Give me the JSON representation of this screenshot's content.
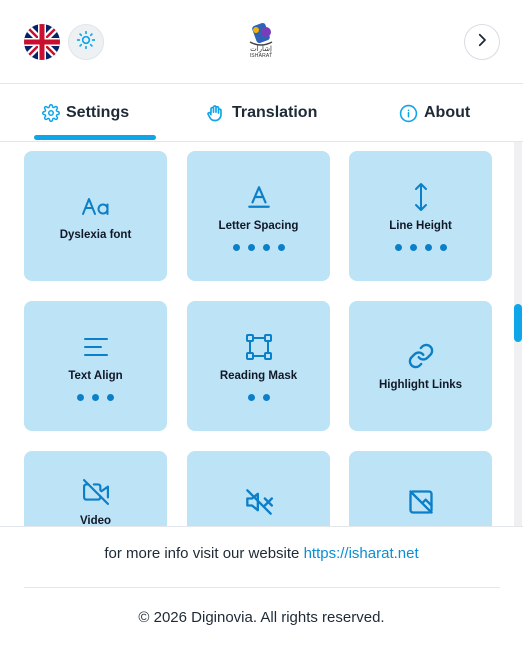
{
  "header": {
    "language_flag": "uk-flag-icon",
    "theme_icon": "sun-icon",
    "logo_text": "ISHARAT",
    "next_icon": "chevron-right-icon"
  },
  "tabs": [
    {
      "label": "Settings",
      "icon": "gear-icon",
      "active": true
    },
    {
      "label": "Translation",
      "icon": "hand-icon",
      "active": false
    },
    {
      "label": "About",
      "icon": "info-icon",
      "active": false
    }
  ],
  "tiles": [
    {
      "label": "Dyslexia font",
      "icon": "font-aa-icon",
      "dots": 0
    },
    {
      "label": "Letter Spacing",
      "icon": "letter-spacing-icon",
      "dots": 4
    },
    {
      "label": "Line Height",
      "icon": "line-height-icon",
      "dots": 4
    },
    {
      "label": "Text Align",
      "icon": "text-align-icon",
      "dots": 3
    },
    {
      "label": "Reading Mask",
      "icon": "reading-mask-icon",
      "dots": 2
    },
    {
      "label": "Highlight Links",
      "icon": "link-icon",
      "dots": 0
    },
    {
      "label": "Video",
      "icon": "video-off-icon",
      "dots": 0
    },
    {
      "label": "",
      "icon": "sound-off-icon",
      "dots": 0
    },
    {
      "label": "",
      "icon": "image-off-icon",
      "dots": 0
    }
  ],
  "footer": {
    "info_text": "for more info visit our website ",
    "info_link": "https://isharat.net",
    "copyright": "© 2026 Diginovia. All rights reserved."
  },
  "colors": {
    "accent": "#0ea5e9",
    "tile_bg": "#bde3f6",
    "dot": "#0b7fc7"
  }
}
